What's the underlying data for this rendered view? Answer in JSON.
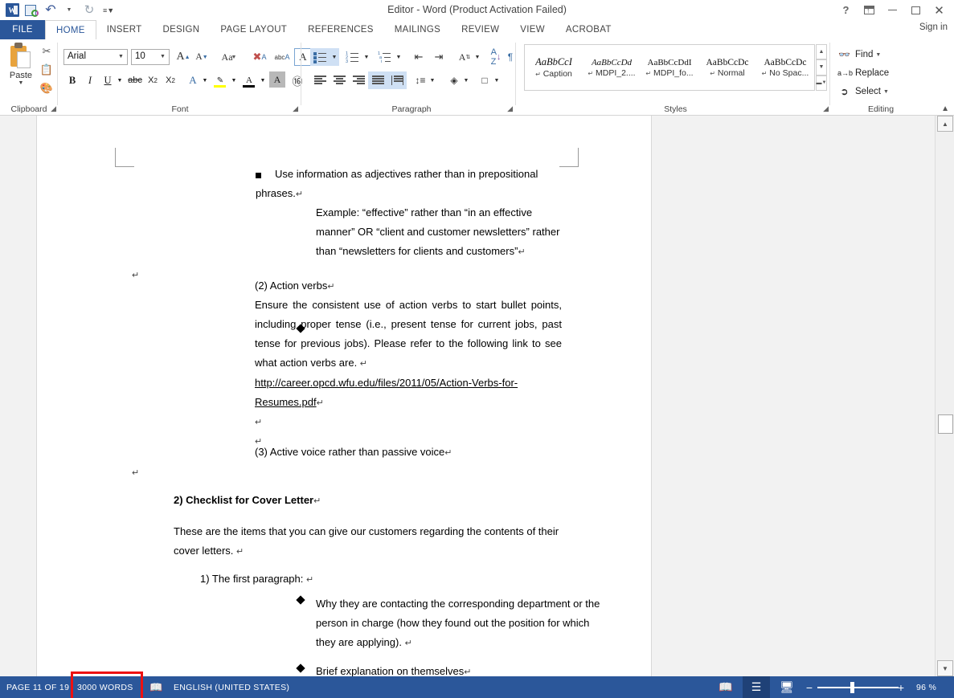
{
  "titlebar": {
    "app_icon": "word-logo",
    "title": "Editor - Word (Product Activation Failed)",
    "quick_access": [
      {
        "name": "save-icon",
        "label": "Save"
      },
      {
        "name": "undo-icon",
        "label": "Undo"
      },
      {
        "name": "redo-icon",
        "label": "Redo"
      },
      {
        "name": "customize-qat-icon",
        "label": "Customize Quick Access Toolbar"
      }
    ],
    "window_controls": {
      "help": "?",
      "ribbon_display": "Ribbon Display Options",
      "minimize": "Minimize",
      "maximize": "Maximize",
      "close": "Close"
    },
    "sign_in": "Sign in"
  },
  "tabs": [
    {
      "label": "FILE",
      "active": false,
      "is_file": true
    },
    {
      "label": "HOME",
      "active": true
    },
    {
      "label": "INSERT",
      "active": false
    },
    {
      "label": "DESIGN",
      "active": false
    },
    {
      "label": "PAGE LAYOUT",
      "active": false
    },
    {
      "label": "REFERENCES",
      "active": false
    },
    {
      "label": "MAILINGS",
      "active": false
    },
    {
      "label": "REVIEW",
      "active": false
    },
    {
      "label": "VIEW",
      "active": false
    },
    {
      "label": "ACROBAT",
      "active": false
    }
  ],
  "ribbon": {
    "clipboard": {
      "group_label": "Clipboard",
      "paste_label": "Paste",
      "cut": "Cut",
      "copy": "Copy",
      "format_painter": "Format Painter"
    },
    "font": {
      "group_label": "Font",
      "font_name": "Arial",
      "font_size": "10",
      "grow_font": "Grow Font",
      "shrink_font": "Shrink Font",
      "change_case": "Aa",
      "clear_formatting": "Clear All Formatting",
      "text_effects": "Text Effects",
      "bold": "B",
      "italic": "I",
      "underline": "U",
      "strikethrough": "abc",
      "subscript": "X",
      "superscript": "X",
      "highlight_color": "Text Highlight Color",
      "font_color": "Font Color",
      "phonetic_guide": "Phonetic Guide",
      "character_border": "Character Border",
      "character_shading": "Character Shading",
      "enclose_characters": "Enclose Characters"
    },
    "paragraph": {
      "group_label": "Paragraph",
      "bullets": "Bullets",
      "numbering": "Numbering",
      "multilevel_list": "Multilevel List",
      "decrease_indent": "Decrease Indent",
      "increase_indent": "Increase Indent",
      "asian_layout": "Asian Layout",
      "sort": "Sort",
      "show_marks": "Show/Hide Formatting Marks",
      "align_left": "Align Left",
      "align_center": "Center",
      "align_right": "Align Right",
      "justify": "Justify",
      "distributed": "Distributed",
      "line_spacing": "Line and Paragraph Spacing",
      "shading": "Shading",
      "borders": "Borders"
    },
    "styles": {
      "group_label": "Styles",
      "items": [
        {
          "preview": "AaBbCcI",
          "name": "Caption",
          "italic": true,
          "serif": true
        },
        {
          "preview": "AaBbCcDd",
          "name": "MDPI_2....",
          "italic": true,
          "serif": true
        },
        {
          "preview": "AaBbCcDdI",
          "name": "MDPI_fo...",
          "italic": false,
          "serif": true
        },
        {
          "preview": "AaBbCcDc",
          "name": "Normal",
          "italic": false,
          "serif": true
        },
        {
          "preview": "AaBbCcDc",
          "name": "No Spac...",
          "italic": false,
          "serif": true
        }
      ]
    },
    "editing": {
      "group_label": "Editing",
      "find": "Find",
      "replace": "Replace",
      "select": "Select"
    },
    "collapse_ribbon": "Collapse the Ribbon"
  },
  "document": {
    "blocks": [
      {
        "kind": "bullet-square",
        "lines": [
          "Use information as adjectives rather than in prepositional",
          "phrases."
        ]
      },
      {
        "kind": "bullet-diamond",
        "lines": [
          "Example: “effective” rather than “in an effective",
          "manner” OR “client and customer newsletters” rather",
          "than “newsletters for clients and customers”"
        ]
      },
      {
        "kind": "plain",
        "lines": [
          "(2) Action verbs"
        ]
      },
      {
        "kind": "justified",
        "lines": [
          "Ensure the consistent use of action verbs to start bullet points,",
          "including proper tense (i.e., present tense for current jobs, past",
          "tense for previous jobs). Please refer to the following link to see",
          "what action verbs are. "
        ]
      },
      {
        "kind": "link",
        "lines": [
          "http://career.opcd.wfu.edu/files/2011/05/Action-Verbs-for-",
          "Resumes.pdf"
        ]
      },
      {
        "kind": "empty",
        "lines": [
          ""
        ]
      },
      {
        "kind": "empty",
        "lines": [
          ""
        ]
      },
      {
        "kind": "plain",
        "lines": [
          "(3) Active voice rather than passive voice"
        ]
      },
      {
        "kind": "heading",
        "lines": [
          "2) Checklist for Cover Letter"
        ]
      },
      {
        "kind": "justified",
        "lines": [
          "These are the items that you can give our customers regarding the contents of their",
          "cover letters. "
        ]
      },
      {
        "kind": "plain-indent",
        "lines": [
          "1) The first paragraph: "
        ]
      },
      {
        "kind": "bullet-diamond",
        "lines": [
          "Why they are contacting the corresponding department or the",
          "person in charge (how they found out the position for which",
          "they are applying). "
        ]
      },
      {
        "kind": "bullet-diamond",
        "lines": [
          "Brief explanation on themselves"
        ]
      }
    ],
    "pilcrow": "↵",
    "left_margin_marks": [
      "↵",
      "↵"
    ]
  },
  "statusbar": {
    "page": "PAGE 11 OF 19",
    "words": "3000 WORDS",
    "words_highlight_color": "#ee1111",
    "proofing_icon": "spell-check-icon",
    "language": "ENGLISH (UNITED STATES)",
    "views": [
      {
        "name": "read-mode-icon",
        "label": "Read Mode",
        "active": false
      },
      {
        "name": "print-layout-icon",
        "label": "Print Layout",
        "active": true
      },
      {
        "name": "web-layout-icon",
        "label": "Web Layout",
        "active": false
      }
    ],
    "zoom_out": "−",
    "zoom_in": "+",
    "zoom_level": "96 %",
    "accent_color": "#2b579a"
  },
  "scrollbar": {
    "up_arrow": "▲",
    "down_arrow": "▼",
    "thumb": "scroll-thumb"
  }
}
